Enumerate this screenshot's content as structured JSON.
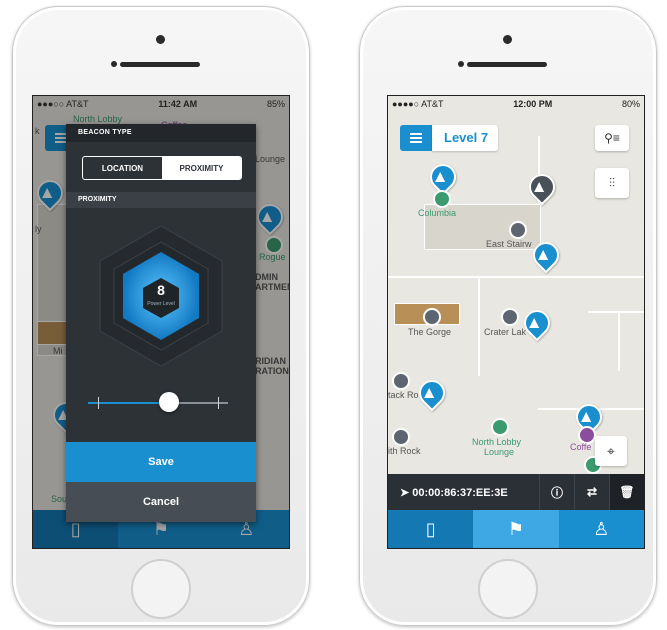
{
  "left_phone": {
    "status": {
      "carrier": "●●●○○ AT&T",
      "time": "11:42 AM",
      "battery": "85%"
    },
    "map_labels": {
      "north_lobby": "North Lobby",
      "coffee": "Coffee",
      "lounge": "Lounge",
      "rogue": "Rogue",
      "admin": "DMIN\nARTMEN",
      "meridian": "RIDIAN\nRATION",
      "sou": "Sou",
      "mi": "Mi",
      "ly": "ly",
      "k": "k"
    },
    "modal": {
      "title": "BEACON TYPE",
      "segments": [
        "LOCATION",
        "PROXIMITY"
      ],
      "selected_segment": "PROXIMITY",
      "section_label": "PROXIMITY",
      "power_level": "8",
      "power_level_label": "Power Level",
      "slider_fraction": 0.58,
      "save_label": "Save",
      "cancel_label": "Cancel"
    },
    "tabs": [
      "map-icon",
      "flag-icon",
      "user-icon"
    ]
  },
  "right_phone": {
    "status": {
      "carrier": "●●●●○ AT&T",
      "time": "12:00 PM",
      "battery": "80%"
    },
    "level_label": "Level 7",
    "map_labels": {
      "columbia": "Columbia",
      "east_stairs": "East Stairw",
      "the_gorge": "The Gorge",
      "crater_lake": "Crater Lak",
      "stack_rock": "tack Ro",
      "haystack": "ith Rock",
      "north_lobby": "North Lobby",
      "lounge": "Lounge",
      "coffee": "Coffe"
    },
    "beacon_bar": {
      "id": "00:00:86:37:EE:3E"
    },
    "tabs": [
      "map-icon",
      "flag-icon",
      "user-icon"
    ],
    "active_tab": "flag-icon"
  },
  "colors": {
    "accent": "#1a8fd0",
    "dark_panel": "#2d3237",
    "green": "#3c9a6f",
    "purple": "#8b4d9e"
  }
}
